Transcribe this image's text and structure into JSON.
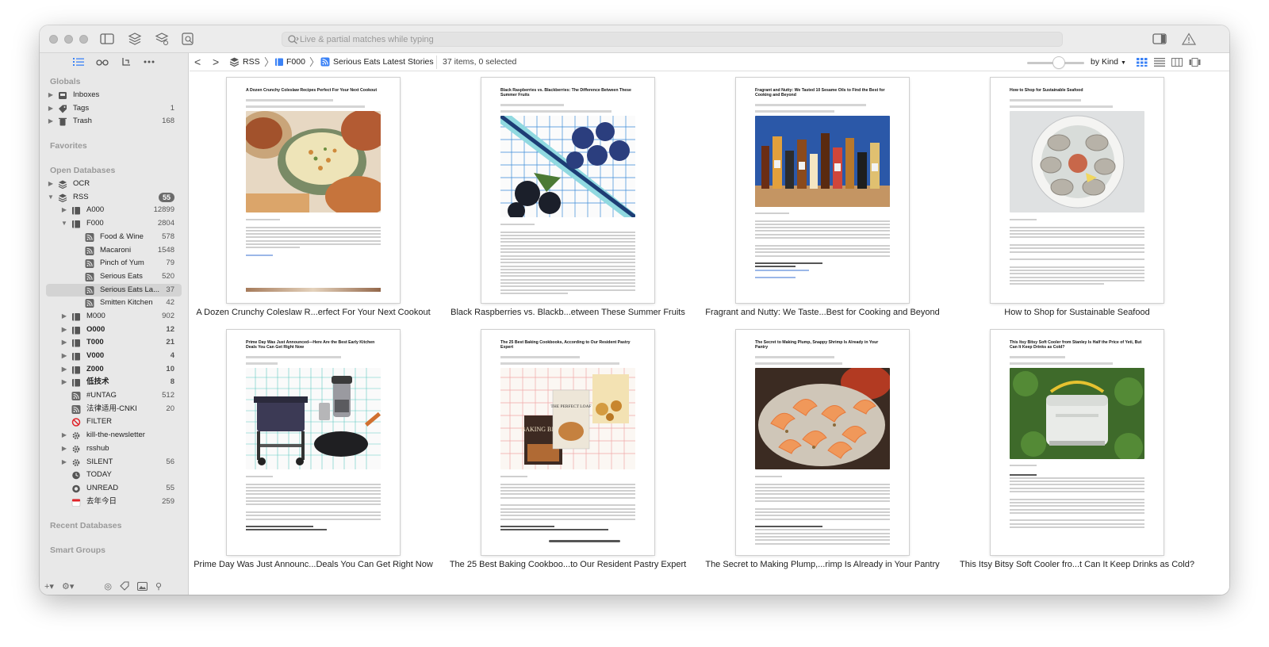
{
  "toolbar": {
    "search_placeholder": "Live & partial matches while typing"
  },
  "sidebar": {
    "sections": {
      "globals": "Globals",
      "favorites": "Favorites",
      "open_databases": "Open Databases",
      "recent_databases": "Recent Databases",
      "smart_groups": "Smart Groups"
    },
    "globals": [
      {
        "label": "Inboxes",
        "count": ""
      },
      {
        "label": "Tags",
        "count": "1"
      },
      {
        "label": "Trash",
        "count": "168"
      }
    ],
    "databases": [
      {
        "label": "OCR",
        "count": ""
      },
      {
        "label": "RSS",
        "count": "55"
      }
    ],
    "rss_groups": [
      {
        "label": "A000",
        "count": "12899"
      },
      {
        "label": "F000",
        "count": "2804"
      },
      {
        "label": "Food & Wine",
        "count": "578"
      },
      {
        "label": "Macaroni",
        "count": "1548"
      },
      {
        "label": "Pinch of Yum",
        "count": "79"
      },
      {
        "label": "Serious Eats",
        "count": "520"
      },
      {
        "label": "Serious Eats La...",
        "count": "37"
      },
      {
        "label": "Smitten Kitchen",
        "count": "42"
      },
      {
        "label": "M000",
        "count": "902"
      },
      {
        "label": "O000",
        "count": "12"
      },
      {
        "label": "T000",
        "count": "21"
      },
      {
        "label": "V000",
        "count": "4"
      },
      {
        "label": "Z000",
        "count": "10"
      },
      {
        "label": "低技术",
        "count": "8"
      },
      {
        "label": "#UNTAG",
        "count": "512"
      },
      {
        "label": "法律适用-CNKI",
        "count": "20"
      },
      {
        "label": "FILTER",
        "count": ""
      },
      {
        "label": "kill-the-newsletter",
        "count": ""
      },
      {
        "label": "rsshub",
        "count": ""
      },
      {
        "label": "SILENT",
        "count": "56"
      },
      {
        "label": "TODAY",
        "count": ""
      },
      {
        "label": "UNREAD",
        "count": "55"
      },
      {
        "label": "去年今日",
        "count": "259"
      }
    ]
  },
  "pathbar": {
    "crumbs": [
      "RSS",
      "F000",
      "Serious Eats Latest Stories"
    ],
    "status": "37 items, 0 selected",
    "sort": "by Kind"
  },
  "items": [
    {
      "caption": "A Dozen Crunchy Coleslaw R...erfect For Your Next Cookout",
      "title": "A Dozen Crunchy Coleslaw Recipes Perfect For Your Next Cookout"
    },
    {
      "caption": "Black Raspberries vs. Blackb...etween These Summer Fruits",
      "title": "Black Raspberries vs. Blackberries: The Difference Between These Summer Fruits"
    },
    {
      "caption": "Fragrant and Nutty: We Taste...Best for Cooking and Beyond",
      "title": "Fragrant and Nutty: We Tasted 10 Sesame Oils to Find the Best for Cooking and Beyond"
    },
    {
      "caption": "How to Shop for Sustainable Seafood",
      "title": "How to Shop for Sustainable Seafood"
    },
    {
      "caption": "Prime Day Was Just Announc...Deals You Can Get Right Now",
      "title": "Prime Day Was Just Announced—Here Are the Best Early Kitchen Deals You Can Get Right Now"
    },
    {
      "caption": "The 25 Best Baking Cookboo...to Our Resident Pastry Expert",
      "title": "The 25 Best Baking Cookbooks, According to Our Resident Pastry Expert"
    },
    {
      "caption": "The Secret to Making Plump,...rimp Is Already in Your Pantry",
      "title": "The Secret to Making Plump, Snappy Shrimp Is Already in Your Pantry"
    },
    {
      "caption": "This Itsy Bitsy Soft Cooler fro...t Can It Keep Drinks as Cold?",
      "title": "This Itsy Bitsy Soft Cooler from Stanley Is Half the Price of Yeti, But Can It Keep Drinks as Cold?"
    }
  ],
  "thumb_texts": {
    "book1": "BAKING BIBLE",
    "book2": "THE PERFECT LOAF"
  },
  "colors": {
    "accent": "#3b82f6",
    "sidebar_bg": "#e8e8e8",
    "selected_row": "#d3d3d3"
  }
}
